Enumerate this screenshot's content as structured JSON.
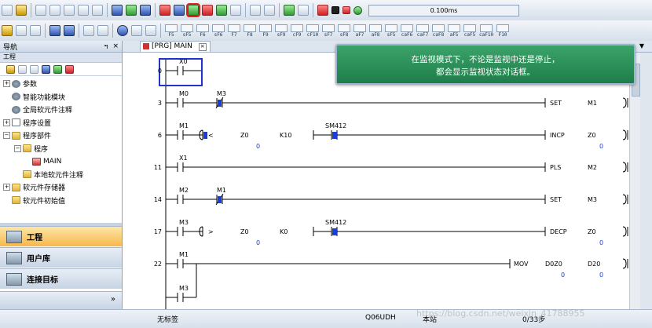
{
  "toolbar": {
    "scan_time": "0.100ms",
    "function_keys": [
      "F5",
      "sF5",
      "F6",
      "sF6",
      "F7",
      "F8",
      "F9",
      "sF9",
      "cF9",
      "cF10",
      "sF7",
      "sF8",
      "aF7",
      "aF8",
      "sF5",
      "caF6",
      "caF7",
      "caF8",
      "aF5",
      "caF5",
      "caF10",
      "F10"
    ]
  },
  "nav": {
    "title": "导航",
    "pin": "ฯ",
    "close": "×",
    "section": "工程",
    "tree": [
      {
        "label": "参数",
        "indent": 0,
        "exp": "+",
        "icon": "gear"
      },
      {
        "label": "智能功能模块",
        "indent": 0,
        "exp": "",
        "icon": "gear"
      },
      {
        "label": "全局软元件注释",
        "indent": 0,
        "exp": "",
        "icon": "gear"
      },
      {
        "label": "程序设置",
        "indent": 0,
        "exp": "+",
        "icon": "doc"
      },
      {
        "label": "程序部件",
        "indent": 0,
        "exp": "−",
        "icon": "folder"
      },
      {
        "label": "程序",
        "indent": 1,
        "exp": "−",
        "icon": "folder"
      },
      {
        "label": "MAIN",
        "indent": 2,
        "exp": "",
        "icon": "prog"
      },
      {
        "label": "本地软元件注释",
        "indent": 1,
        "exp": "",
        "icon": "folder"
      },
      {
        "label": "软元件存储器",
        "indent": 0,
        "exp": "+",
        "icon": "folder"
      },
      {
        "label": "软元件初始值",
        "indent": 0,
        "exp": "",
        "icon": "folder"
      }
    ],
    "buttons": [
      {
        "label": "工程",
        "active": true
      },
      {
        "label": "用户库",
        "active": false
      },
      {
        "label": "连接目标",
        "active": false
      }
    ],
    "more": "»"
  },
  "editor_tab": {
    "label": "[PRG] MAIN",
    "close": "×"
  },
  "callout": {
    "line1": "在监视模式下，不论是监视中还是停止，",
    "line2": "都会显示监视状态对话框。"
  },
  "ladder": {
    "steps": [
      "0",
      "3",
      "6",
      "11",
      "14",
      "17",
      "22"
    ],
    "contacts": [
      "X0",
      "M0",
      "M3",
      "M1",
      "X1",
      "M2",
      "M1",
      "M3",
      "M1",
      "M3",
      "SM412",
      "SM412"
    ],
    "compare": [
      {
        "op": "<",
        "a": "Z0",
        "a_val": "0",
        "b": "K10"
      },
      {
        "op": ">",
        "a": "Z0",
        "a_val": "0",
        "b": "K0"
      }
    ],
    "instructions": [
      {
        "name": "SET",
        "arg": "M1"
      },
      {
        "name": "INCP",
        "arg": "Z0",
        "val": "0"
      },
      {
        "name": "PLS",
        "arg": "M2"
      },
      {
        "name": "SET",
        "arg": "M3"
      },
      {
        "name": "DECP",
        "arg": "Z0",
        "val": "0"
      },
      {
        "name": "MOV",
        "arg": "D0Z0",
        "val": "0",
        "arg2": "D20",
        "val2": "0"
      }
    ]
  },
  "status": {
    "title": "无标签",
    "cpu": "Q06UDH",
    "station": "本站",
    "steps": "0/33步"
  },
  "watermark": "https://blog.csdn.net/weixin_41788955"
}
